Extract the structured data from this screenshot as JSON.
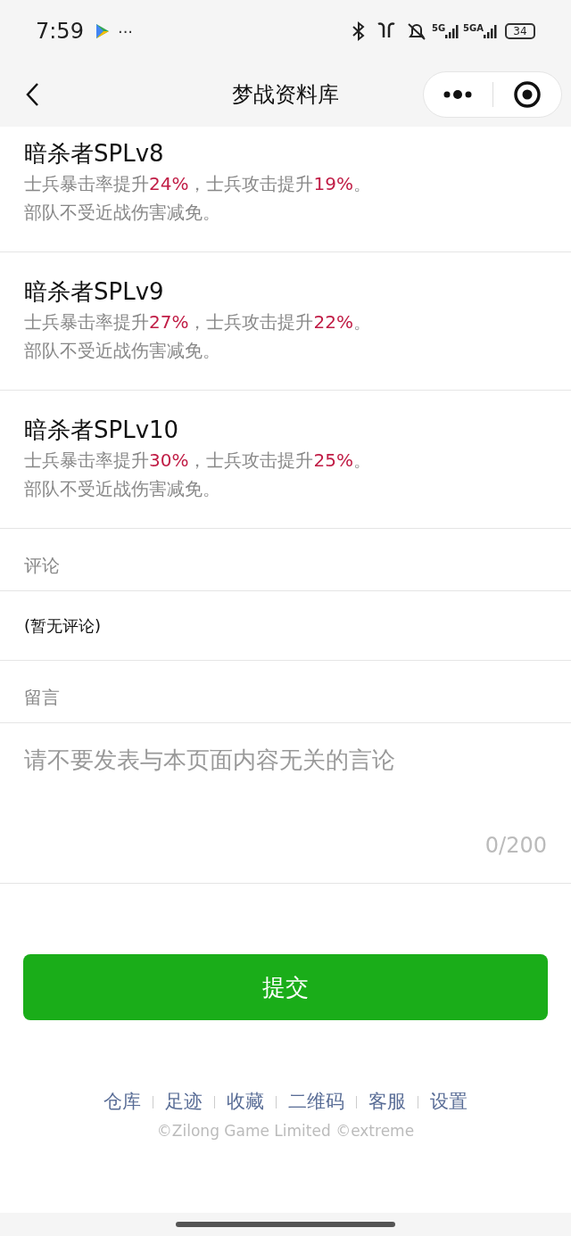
{
  "status_bar": {
    "time": "7:59",
    "more": "···",
    "signals": [
      "5G",
      "5GA"
    ],
    "battery": "34"
  },
  "nav": {
    "title": "梦战资料库"
  },
  "skills": [
    {
      "title": "暗杀者SPLv8",
      "lines": [
        [
          {
            "text": "士兵暴击率提升",
            "highlight": false
          },
          {
            "text": "24%",
            "highlight": true
          },
          {
            "text": "，士兵攻击提升",
            "highlight": false
          },
          {
            "text": "19%",
            "highlight": true
          },
          {
            "text": "。",
            "highlight": false
          }
        ],
        [
          {
            "text": "部队不受近战伤害减免。",
            "highlight": false
          }
        ]
      ]
    },
    {
      "title": "暗杀者SPLv9",
      "lines": [
        [
          {
            "text": "士兵暴击率提升",
            "highlight": false
          },
          {
            "text": "27%",
            "highlight": true
          },
          {
            "text": "，士兵攻击提升",
            "highlight": false
          },
          {
            "text": "22%",
            "highlight": true
          },
          {
            "text": "。",
            "highlight": false
          }
        ],
        [
          {
            "text": "部队不受近战伤害减免。",
            "highlight": false
          }
        ]
      ]
    },
    {
      "title": "暗杀者SPLv10",
      "lines": [
        [
          {
            "text": "士兵暴击率提升",
            "highlight": false
          },
          {
            "text": "30%",
            "highlight": true
          },
          {
            "text": "，士兵攻击提升",
            "highlight": false
          },
          {
            "text": "25%",
            "highlight": true
          },
          {
            "text": "。",
            "highlight": false
          }
        ],
        [
          {
            "text": "部队不受近战伤害减免。",
            "highlight": false
          }
        ]
      ]
    }
  ],
  "comments": {
    "label": "评论",
    "empty": "(暂无评论)"
  },
  "message": {
    "label": "留言",
    "placeholder": "请不要发表与本页面内容无关的言论",
    "counter": "0/200"
  },
  "submit": "提交",
  "footer": {
    "links": [
      "仓库",
      "足迹",
      "收藏",
      "二维码",
      "客服",
      "设置"
    ],
    "copyright": "©Zilong Game Limited ©extreme"
  }
}
